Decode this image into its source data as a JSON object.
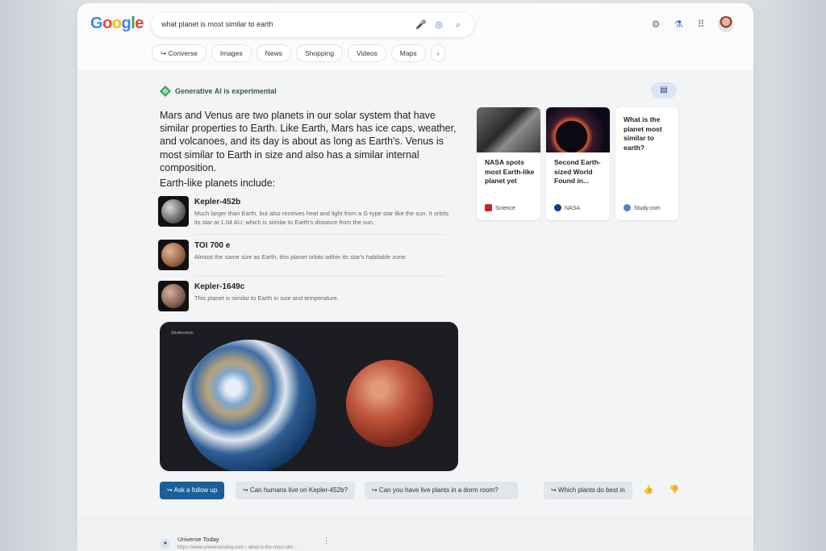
{
  "header": {
    "logo": "Google",
    "query": "what planet is most similar to earth",
    "tabs": [
      "Converse",
      "Images",
      "News",
      "Shopping",
      "Videos",
      "Maps"
    ],
    "tab_more": "›",
    "icons": [
      "mic-icon",
      "lens-icon",
      "search-icon",
      "settings-icon",
      "labs-icon",
      "apps-icon"
    ]
  },
  "ai": {
    "badge": "Generative AI is experimental",
    "summary": "Mars and Venus are two planets in our solar system that have similar properties to Earth. Like Earth, Mars has ice caps, weather, and volcanoes, and its day is about as long as Earth's. Venus is most similar to Earth in size and also has a similar internal composition.",
    "subheading": "Earth-like planets include:",
    "planets": [
      {
        "name": "Kepler-452b",
        "desc": "Much larger than Earth, but also receives heat and light from a G-type star like the sun. It orbits its star at 1.04 AU, which is similar to Earth's distance from the sun."
      },
      {
        "name": "TOI 700 e",
        "desc": "Almost the same size as Earth, this planet orbits within its star's habitable zone."
      },
      {
        "name": "Kepler-1649c",
        "desc": "This planet is similar to Earth in size and temperature."
      }
    ],
    "image_credit": "Shutterstock",
    "followups": {
      "primary": "↪ Ask a follow up",
      "items": [
        "↪ Can humans live on Kepler-452b?",
        "↪ Can you have live plants in a dorm room?",
        "↪ Which plants do best in"
      ]
    }
  },
  "cards": [
    {
      "title": "NASA spots most Earth-like planet yet",
      "source": "Science"
    },
    {
      "title": "Second Earth-sized World Found in...",
      "source": "NASA"
    },
    {
      "title": "What is the planet most similar to earth?",
      "source": "Study.com"
    }
  ],
  "result": {
    "site": "Universe Today",
    "url": "https://www.universetoday.com › what-is-the-most-sim..."
  },
  "colors": {
    "accent": "#1a5f98",
    "gen_ai_green": "#2f5d49"
  }
}
